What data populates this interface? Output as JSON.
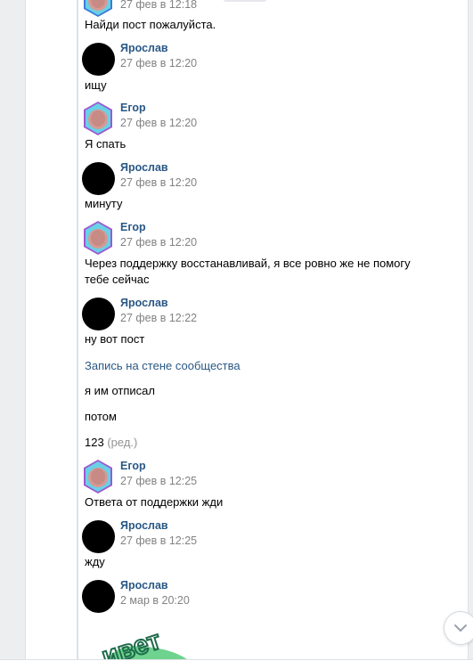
{
  "messages": [
    {
      "time": "27 фев в 12:18",
      "text": "Найди пост пожалуйста."
    },
    {
      "author": "Ярослав",
      "time": "27 фев в 12:20",
      "text": "ищу"
    },
    {
      "author": "Егор",
      "time": "27 фев в 12:20",
      "text": "Я спать"
    },
    {
      "author": "Ярослав",
      "time": "27 фев в 12:20",
      "text": "минуту"
    },
    {
      "author": "Егор",
      "time": "27 фев в 12:20",
      "text": "Через поддержку восстанавливай, я все ровно же не помогу тебе сейчас"
    },
    {
      "author": "Ярослав",
      "time": "27 фев в 12:22",
      "text": "ну вот пост",
      "link": "Запись на стене сообщества",
      "extra": [
        "я им отписал",
        "потом"
      ],
      "edited_text": "123",
      "edited_label": "(ред.)"
    },
    {
      "author": "Егор",
      "time": "27 фев в 12:25",
      "text": "Ответа от поддержки жди"
    },
    {
      "author": "Ярослав",
      "time": "27 фев в 12:25",
      "text": "жду"
    },
    {
      "author": "Ярослав",
      "time": "2 мар в 20:20",
      "sticker_text": "ивет"
    }
  ],
  "colors": {
    "author": "#2a5885",
    "time": "#828282",
    "link": "#2a5885",
    "sticker_green": "#6ed38f"
  },
  "icons": {
    "scroll_down": "chevron-down-icon"
  }
}
